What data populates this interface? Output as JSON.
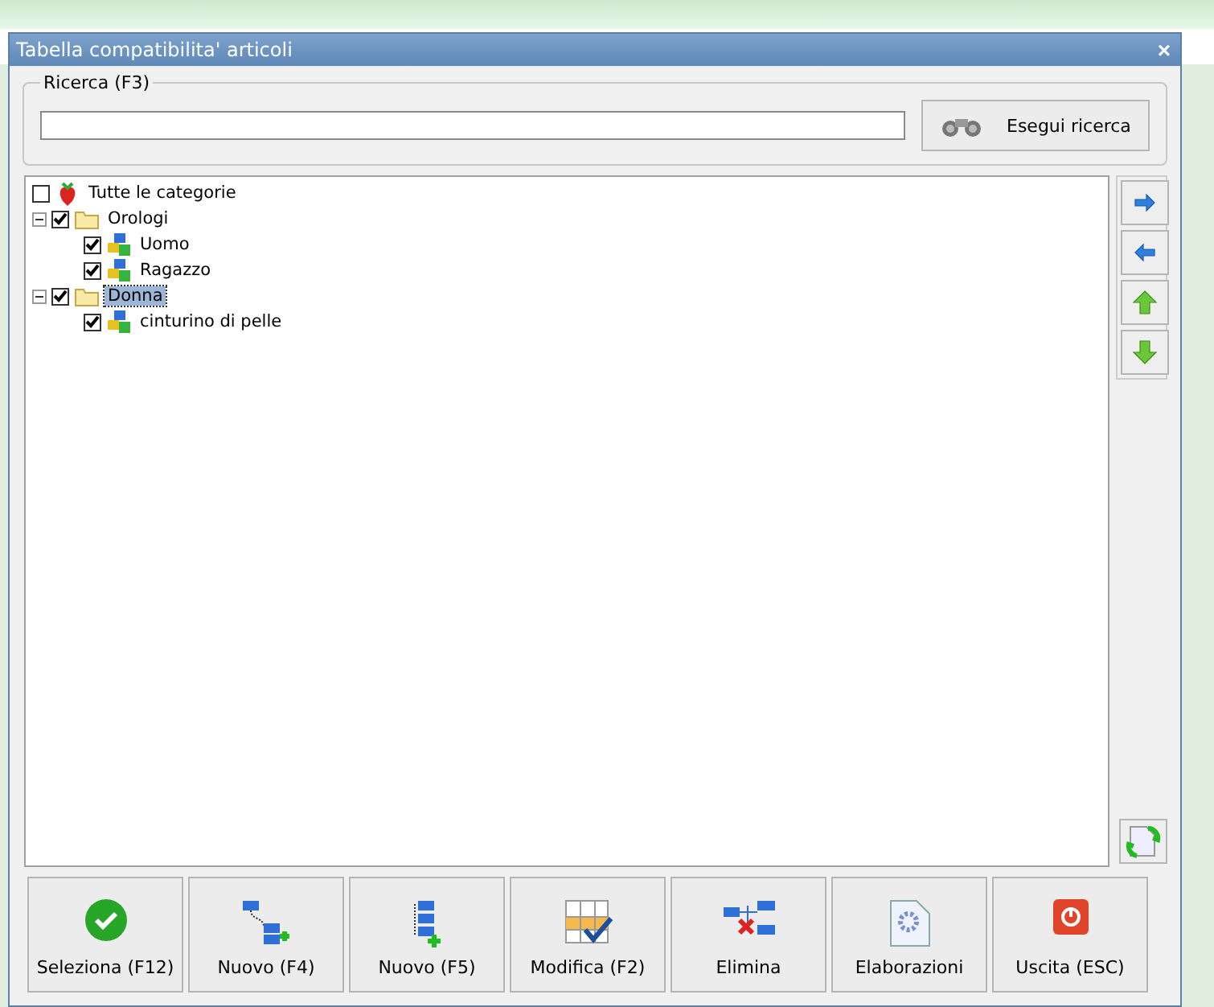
{
  "dialog": {
    "title": "Tabella compatibilita' articoli",
    "close_label": "×"
  },
  "search": {
    "legend": "Ricerca (F3)",
    "button": "Esegui ricerca"
  },
  "tree": [
    {
      "label": "Tutte le categorie",
      "kind": "root",
      "checked": false,
      "selected": false
    },
    {
      "label": "Orologi",
      "kind": "category",
      "checked": true,
      "selected": false,
      "expanded": true,
      "children": [
        {
          "label": "Uomo",
          "kind": "item",
          "checked": true,
          "selected": false
        },
        {
          "label": "Ragazzo",
          "kind": "item",
          "checked": true,
          "selected": false
        }
      ]
    },
    {
      "label": "Donna",
      "kind": "category",
      "checked": true,
      "selected": true,
      "expanded": true,
      "children": [
        {
          "label": "cinturino di pelle",
          "kind": "item",
          "checked": true,
          "selected": false
        }
      ]
    }
  ],
  "side_buttons": [
    {
      "kind": "right"
    },
    {
      "kind": "left"
    },
    {
      "kind": "up"
    },
    {
      "kind": "down"
    }
  ],
  "toolbar": [
    {
      "label": "Seleziona (F12)",
      "kind": "check"
    },
    {
      "label": "Nuovo (F4)",
      "kind": "new-child"
    },
    {
      "label": "Nuovo (F5)",
      "kind": "new-sibling"
    },
    {
      "label": "Modifica (F2)",
      "kind": "edit"
    },
    {
      "label": "Elimina",
      "kind": "delete"
    },
    {
      "label": "Elaborazioni",
      "kind": "process"
    },
    {
      "label": "Uscita (ESC)",
      "kind": "exit"
    }
  ]
}
